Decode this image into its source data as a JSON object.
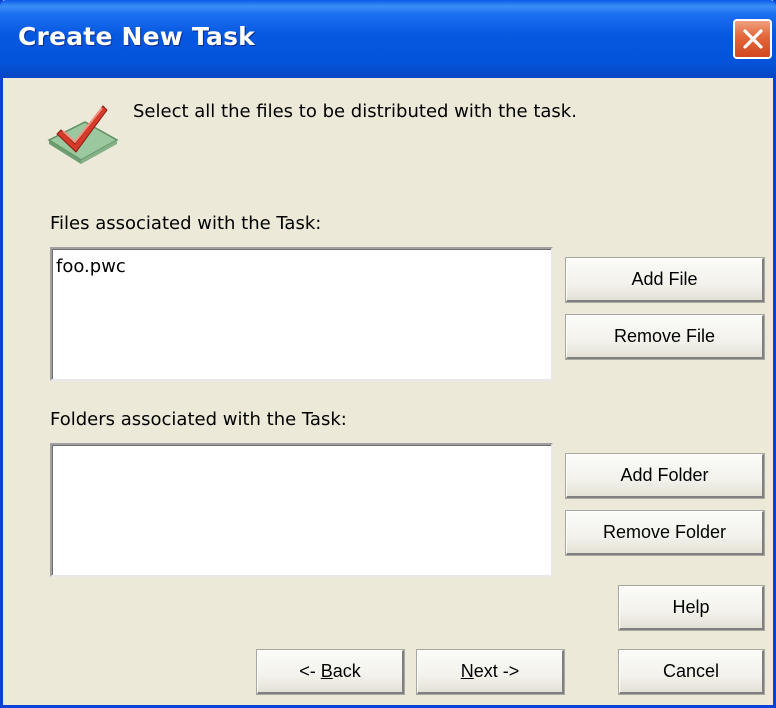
{
  "window": {
    "title": "Create New Task"
  },
  "header": {
    "instruction": "Select all the files to be distributed with the task.",
    "icon": "checkmark-icon"
  },
  "files": {
    "label": "Files associated with the Task:",
    "items": [
      "foo.pwc"
    ],
    "add_label": "Add File",
    "remove_label": "Remove File"
  },
  "folders": {
    "label": "Folders associated with the Task:",
    "items": [],
    "add_label": "Add Folder",
    "remove_label": "Remove Folder"
  },
  "buttons": {
    "help": "Help",
    "back_prefix": "<- ",
    "back_mnemonic": "B",
    "back_rest": "ack",
    "next_mnemonic": "N",
    "next_rest": "ext ->",
    "cancel": "Cancel"
  },
  "colors": {
    "titlebar": "#0758e0",
    "dialog_background": "#ece9d8",
    "close_button": "#d2461e",
    "check_mark": "#d63a2a"
  }
}
